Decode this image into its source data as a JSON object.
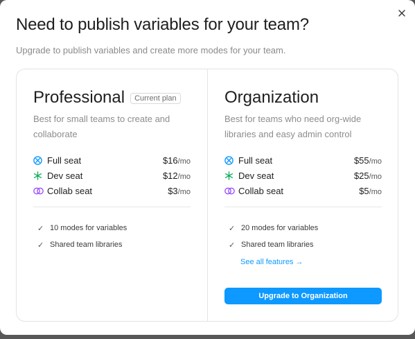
{
  "modal": {
    "title": "Need to publish variables for your team?",
    "subtitle": "Upgrade to publish variables and create more modes for your team.",
    "close_icon": "close-icon"
  },
  "plans": [
    {
      "name": "Professional",
      "badge": "Current plan",
      "description": "Best for small teams to create and collaborate",
      "seats": [
        {
          "icon": "full-seat-icon",
          "label": "Full seat",
          "price": "$16",
          "period": "/mo"
        },
        {
          "icon": "dev-seat-icon",
          "label": "Dev seat",
          "price": "$12",
          "period": "/mo"
        },
        {
          "icon": "collab-seat-icon",
          "label": "Collab seat",
          "price": "$3",
          "period": "/mo"
        }
      ],
      "features": [
        "10 modes for variables",
        "Shared team libraries"
      ]
    },
    {
      "name": "Organization",
      "description": "Best for teams who need org-wide libraries and easy admin control",
      "seats": [
        {
          "icon": "full-seat-icon",
          "label": "Full seat",
          "price": "$55",
          "period": "/mo"
        },
        {
          "icon": "dev-seat-icon",
          "label": "Dev seat",
          "price": "$25",
          "period": "/mo"
        },
        {
          "icon": "collab-seat-icon",
          "label": "Collab seat",
          "price": "$5",
          "period": "/mo"
        }
      ],
      "features": [
        "20 modes for variables",
        "Shared team libraries"
      ],
      "see_all_link": "See all features →",
      "cta_label": "Upgrade to Organization"
    }
  ],
  "colors": {
    "accent": "#0d99ff",
    "full_seat": "#0d99ff",
    "dev_seat": "#14ae5c",
    "collab_seat": "#9747ff"
  }
}
